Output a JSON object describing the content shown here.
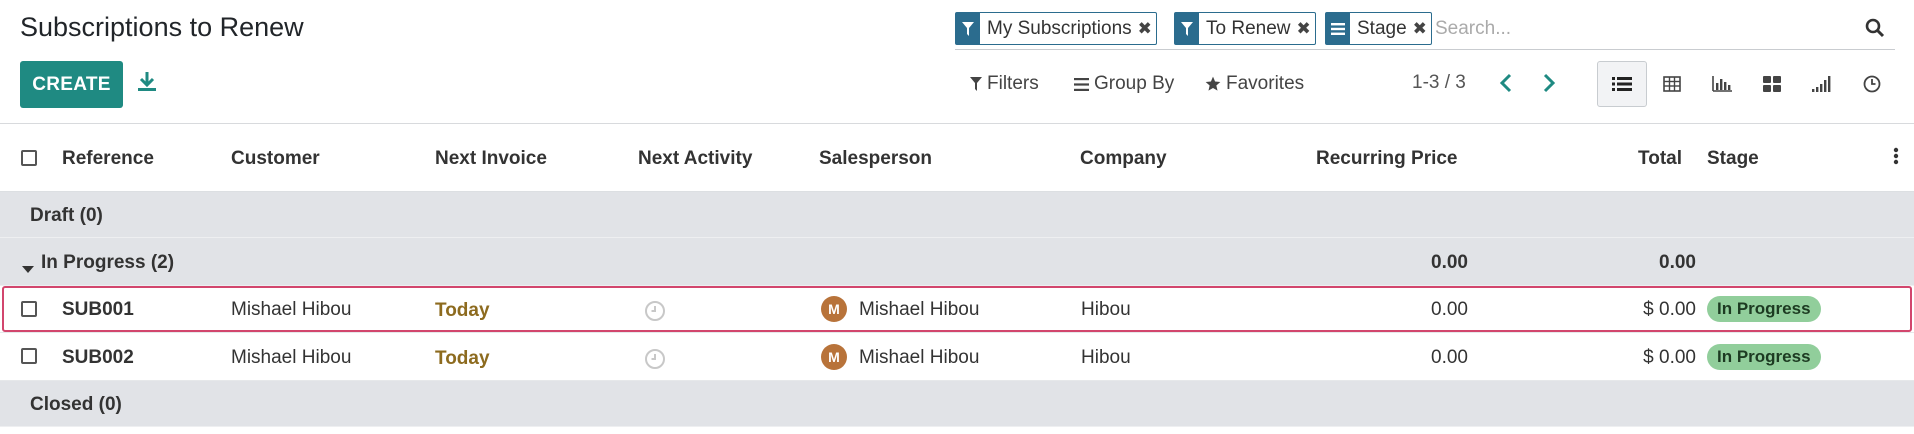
{
  "page": {
    "title": "Subscriptions to Renew",
    "create_label": "CREATE",
    "download_icon": "download-icon"
  },
  "search": {
    "facets": [
      {
        "label": "My Subscriptions",
        "icon": "filter-icon"
      },
      {
        "label": "To Renew",
        "icon": "filter-icon"
      },
      {
        "label": "Stage",
        "icon": "group-list-icon"
      }
    ],
    "placeholder": "Search..."
  },
  "menus": {
    "filters": "Filters",
    "group_by": "Group By",
    "favorites": "Favorites"
  },
  "pager": {
    "value": "1-3 / 3"
  },
  "views": [
    {
      "name": "list",
      "active": true
    },
    {
      "name": "pivot",
      "active": false
    },
    {
      "name": "graph",
      "active": false
    },
    {
      "name": "kanban",
      "active": false
    },
    {
      "name": "cohort",
      "active": false
    },
    {
      "name": "activity",
      "active": false
    }
  ],
  "columns": {
    "reference": "Reference",
    "customer": "Customer",
    "next_invoice": "Next Invoice",
    "next_activity": "Next Activity",
    "salesperson": "Salesperson",
    "company": "Company",
    "recurring_price": "Recurring Price",
    "total": "Total",
    "stage": "Stage"
  },
  "groups": {
    "draft": {
      "label": "Draft (0)"
    },
    "in_progress": {
      "label": "In Progress (2)",
      "recurring_price": "0.00",
      "total": "0.00"
    },
    "closed": {
      "label": "Closed (0)"
    }
  },
  "rows": [
    {
      "reference": "SUB001",
      "customer": "Mishael Hibou",
      "next_invoice": "Today",
      "salesperson_initial": "M",
      "salesperson": "Mishael Hibou",
      "company": "Hibou",
      "recurring_price": "0.00",
      "total": "$ 0.00",
      "stage": "In Progress"
    },
    {
      "reference": "SUB002",
      "customer": "Mishael Hibou",
      "next_invoice": "Today",
      "salesperson_initial": "M",
      "salesperson": "Mishael Hibou",
      "company": "Hibou",
      "recurring_price": "0.00",
      "total": "$ 0.00",
      "stage": "In Progress"
    }
  ],
  "colors": {
    "primary": "#1f8a82",
    "facet": "#2b6c8e",
    "group_bg": "#e1e3e7",
    "today": "#8d6b1f",
    "badge_bg": "#91ce9b",
    "highlight": "#d2466d",
    "avatar": "#b8733a"
  }
}
